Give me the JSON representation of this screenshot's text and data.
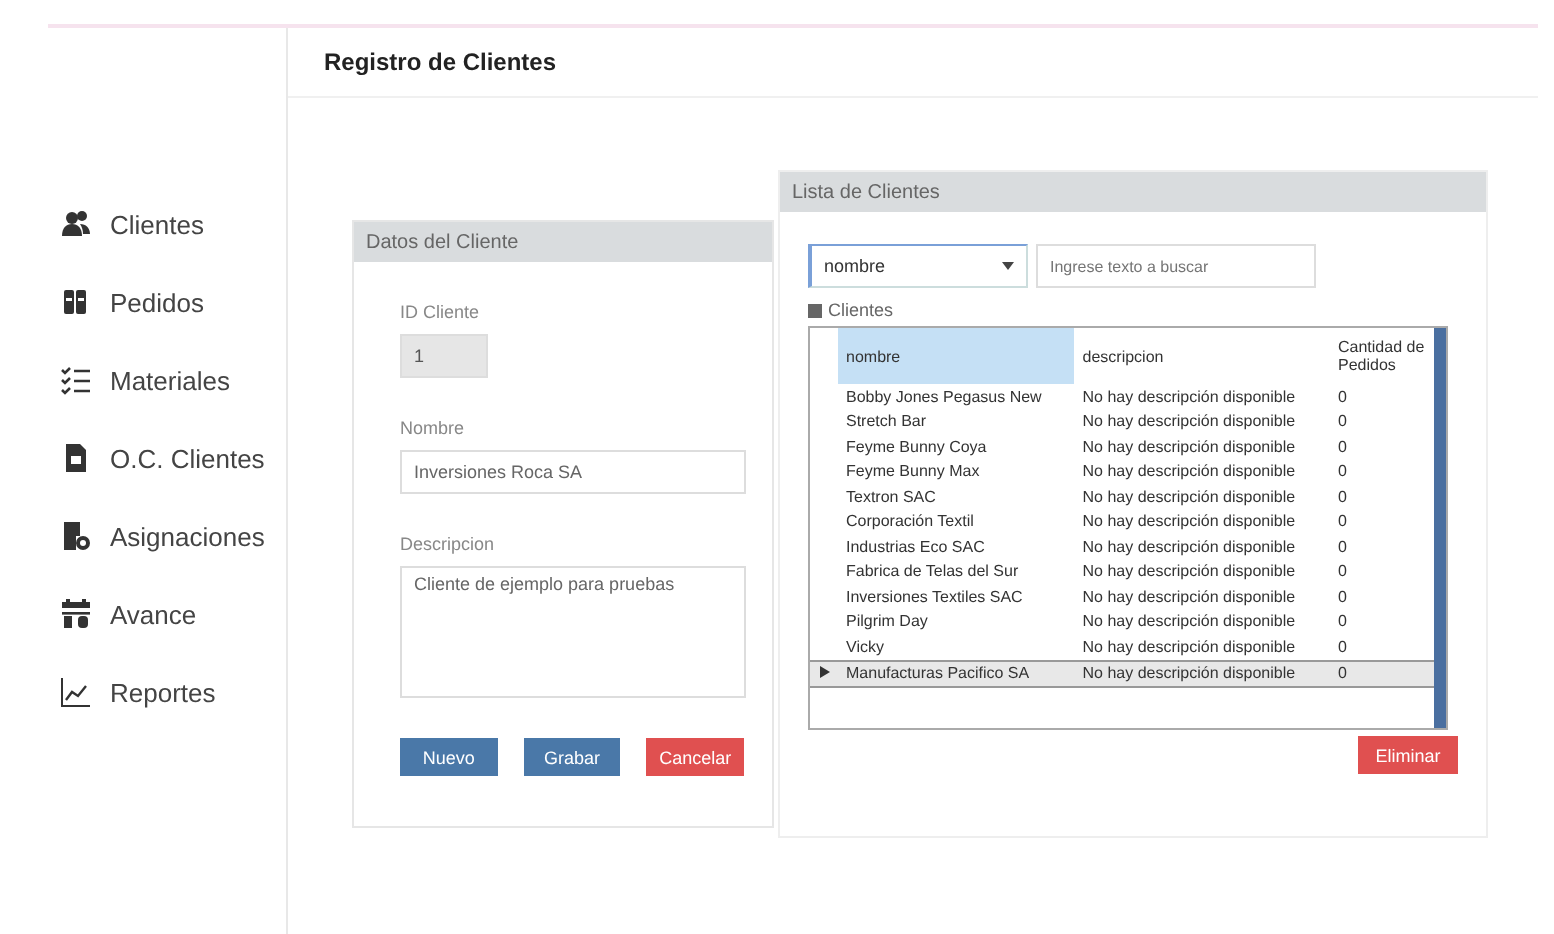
{
  "page": {
    "title": "Registro de Clientes"
  },
  "sidebar": {
    "items": [
      {
        "label": "Clientes"
      },
      {
        "label": "Pedidos"
      },
      {
        "label": "Materiales"
      },
      {
        "label": "O.C. Clientes"
      },
      {
        "label": "Asignaciones"
      },
      {
        "label": "Avance"
      },
      {
        "label": "Reportes"
      }
    ]
  },
  "form": {
    "title": "Datos del Cliente",
    "fields": [
      {
        "kind": "short",
        "label": "ID Cliente",
        "value": "1",
        "disabled": true
      },
      {
        "kind": "line",
        "label": "Nombre",
        "value": "Inversiones Roca SA",
        "disabled": false
      },
      {
        "kind": "area",
        "label": "Descripcion",
        "value": "Cliente de ejemplo para pruebas",
        "disabled": false
      }
    ],
    "buttons": [
      {
        "label": "Nuevo",
        "kind": "primary"
      },
      {
        "label": "Grabar",
        "kind": "primary"
      },
      {
        "label": "Cancelar",
        "kind": "danger"
      }
    ]
  },
  "list": {
    "title": "Lista de Clientes",
    "filter": {
      "value": "nombre"
    },
    "search": {
      "placeholder": "Ingrese texto a buscar"
    },
    "group_label": "Clientes",
    "table": {
      "columns": [
        {
          "label": "nombre",
          "selected": true
        },
        {
          "label": "descripcion",
          "selected": false
        },
        {
          "label": "Cantidad de Pedidos",
          "selected": false
        }
      ],
      "rows": [
        {
          "cells": [
            "Bobby Jones Pegasus New",
            "No hay descripción disponible",
            "0"
          ],
          "selected": false
        },
        {
          "cells": [
            "Stretch Bar",
            "No hay descripción disponible",
            "0"
          ],
          "selected": false
        },
        {
          "cells": [
            "Feyme Bunny Coya",
            "No hay descripción disponible",
            "0"
          ],
          "selected": false
        },
        {
          "cells": [
            "Feyme Bunny Max",
            "No hay descripción disponible",
            "0"
          ],
          "selected": false
        },
        {
          "cells": [
            "Textron SAC",
            "No hay descripción disponible",
            "0"
          ],
          "selected": false
        },
        {
          "cells": [
            "Corporación Textil",
            "No hay descripción disponible",
            "0"
          ],
          "selected": false
        },
        {
          "cells": [
            "Industrias Eco SAC",
            "No hay descripción disponible",
            "0"
          ],
          "selected": false
        },
        {
          "cells": [
            "Fabrica de Telas del Sur",
            "No hay descripción disponible",
            "0"
          ],
          "selected": false
        },
        {
          "cells": [
            "Inversiones Textiles SAC",
            "No hay descripción disponible",
            "0"
          ],
          "selected": false
        },
        {
          "cells": [
            "Pilgrim Day",
            "No hay descripción disponible",
            "0"
          ],
          "selected": false
        },
        {
          "cells": [
            "Vicky",
            "No hay descripción disponible",
            "0"
          ],
          "selected": false
        },
        {
          "cells": [
            "Manufacturas Pacifico SA",
            "No hay descripción disponible",
            "0"
          ],
          "selected": true
        }
      ]
    },
    "delete_button": "Eliminar"
  }
}
